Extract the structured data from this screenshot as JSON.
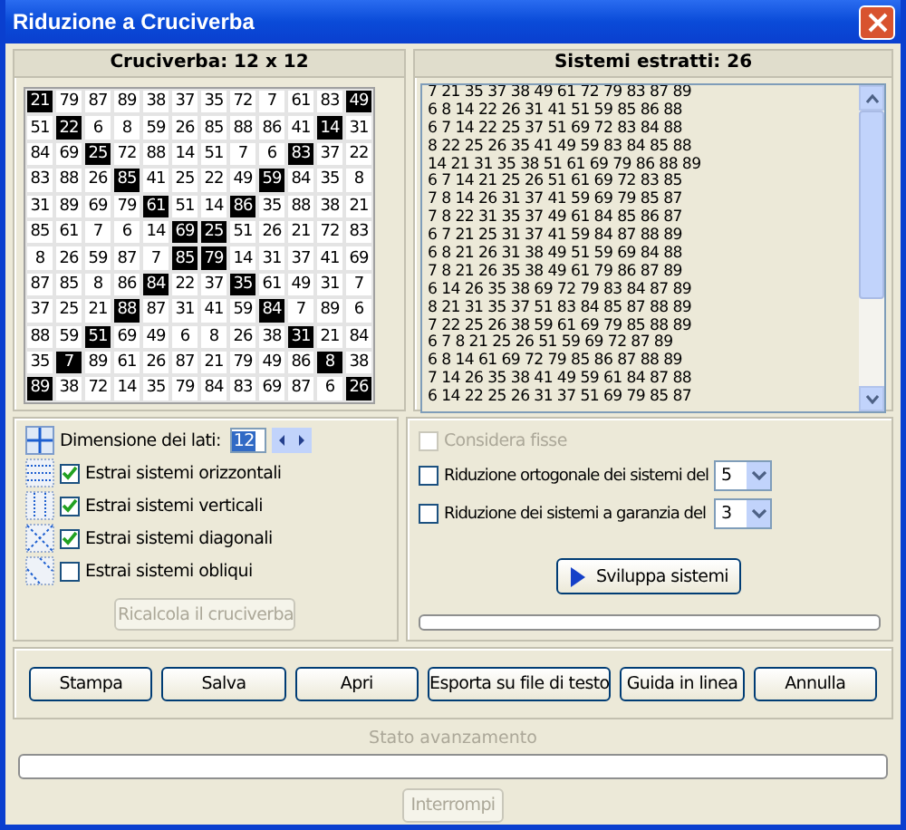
{
  "window": {
    "title": "Riduzione a Cruciverba"
  },
  "grid": {
    "title": "Cruciverba: 12 x 12",
    "rows": [
      [
        {
          "t": "21",
          "marked": true
        },
        {
          "t": "79",
          "marked": false
        },
        {
          "t": "87",
          "marked": false
        },
        {
          "t": "89",
          "marked": false
        },
        {
          "t": "38",
          "marked": false
        },
        {
          "t": "37",
          "marked": false
        },
        {
          "t": "35",
          "marked": false
        },
        {
          "t": "72",
          "marked": false
        },
        {
          "t": "7",
          "marked": false
        },
        {
          "t": "61",
          "marked": false
        },
        {
          "t": "83",
          "marked": false
        },
        {
          "t": "49",
          "marked": true
        }
      ],
      [
        {
          "t": "51",
          "marked": false
        },
        {
          "t": "22",
          "marked": true
        },
        {
          "t": "6",
          "marked": false
        },
        {
          "t": "8",
          "marked": false
        },
        {
          "t": "59",
          "marked": false
        },
        {
          "t": "26",
          "marked": false
        },
        {
          "t": "85",
          "marked": false
        },
        {
          "t": "88",
          "marked": false
        },
        {
          "t": "86",
          "marked": false
        },
        {
          "t": "41",
          "marked": false
        },
        {
          "t": "14",
          "marked": true
        },
        {
          "t": "31",
          "marked": false
        }
      ],
      [
        {
          "t": "84",
          "marked": false
        },
        {
          "t": "69",
          "marked": false
        },
        {
          "t": "25",
          "marked": true
        },
        {
          "t": "72",
          "marked": false
        },
        {
          "t": "88",
          "marked": false
        },
        {
          "t": "14",
          "marked": false
        },
        {
          "t": "51",
          "marked": false
        },
        {
          "t": "7",
          "marked": false
        },
        {
          "t": "6",
          "marked": false
        },
        {
          "t": "83",
          "marked": true
        },
        {
          "t": "37",
          "marked": false
        },
        {
          "t": "22",
          "marked": false
        }
      ],
      [
        {
          "t": "83",
          "marked": false
        },
        {
          "t": "88",
          "marked": false
        },
        {
          "t": "26",
          "marked": false
        },
        {
          "t": "85",
          "marked": true
        },
        {
          "t": "41",
          "marked": false
        },
        {
          "t": "25",
          "marked": false
        },
        {
          "t": "22",
          "marked": false
        },
        {
          "t": "49",
          "marked": false
        },
        {
          "t": "59",
          "marked": true
        },
        {
          "t": "84",
          "marked": false
        },
        {
          "t": "35",
          "marked": false
        },
        {
          "t": "8",
          "marked": false
        }
      ],
      [
        {
          "t": "31",
          "marked": false
        },
        {
          "t": "89",
          "marked": false
        },
        {
          "t": "69",
          "marked": false
        },
        {
          "t": "79",
          "marked": false
        },
        {
          "t": "61",
          "marked": true
        },
        {
          "t": "51",
          "marked": false
        },
        {
          "t": "14",
          "marked": false
        },
        {
          "t": "86",
          "marked": true
        },
        {
          "t": "35",
          "marked": false
        },
        {
          "t": "88",
          "marked": false
        },
        {
          "t": "38",
          "marked": false
        },
        {
          "t": "21",
          "marked": false
        }
      ],
      [
        {
          "t": "85",
          "marked": false
        },
        {
          "t": "61",
          "marked": false
        },
        {
          "t": "7",
          "marked": false
        },
        {
          "t": "6",
          "marked": false
        },
        {
          "t": "14",
          "marked": false
        },
        {
          "t": "69",
          "marked": true
        },
        {
          "t": "25",
          "marked": true
        },
        {
          "t": "51",
          "marked": false
        },
        {
          "t": "26",
          "marked": false
        },
        {
          "t": "21",
          "marked": false
        },
        {
          "t": "72",
          "marked": false
        },
        {
          "t": "83",
          "marked": false
        }
      ],
      [
        {
          "t": "8",
          "marked": false
        },
        {
          "t": "26",
          "marked": false
        },
        {
          "t": "59",
          "marked": false
        },
        {
          "t": "87",
          "marked": false
        },
        {
          "t": "7",
          "marked": false
        },
        {
          "t": "85",
          "marked": true
        },
        {
          "t": "79",
          "marked": true
        },
        {
          "t": "14",
          "marked": false
        },
        {
          "t": "31",
          "marked": false
        },
        {
          "t": "37",
          "marked": false
        },
        {
          "t": "41",
          "marked": false
        },
        {
          "t": "69",
          "marked": false
        }
      ],
      [
        {
          "t": "87",
          "marked": false
        },
        {
          "t": "85",
          "marked": false
        },
        {
          "t": "8",
          "marked": false
        },
        {
          "t": "86",
          "marked": false
        },
        {
          "t": "84",
          "marked": true
        },
        {
          "t": "22",
          "marked": false
        },
        {
          "t": "37",
          "marked": false
        },
        {
          "t": "35",
          "marked": true
        },
        {
          "t": "61",
          "marked": false
        },
        {
          "t": "49",
          "marked": false
        },
        {
          "t": "31",
          "marked": false
        },
        {
          "t": "7",
          "marked": false
        }
      ],
      [
        {
          "t": "37",
          "marked": false
        },
        {
          "t": "25",
          "marked": false
        },
        {
          "t": "21",
          "marked": false
        },
        {
          "t": "88",
          "marked": true
        },
        {
          "t": "87",
          "marked": false
        },
        {
          "t": "31",
          "marked": false
        },
        {
          "t": "41",
          "marked": false
        },
        {
          "t": "59",
          "marked": false
        },
        {
          "t": "84",
          "marked": true
        },
        {
          "t": "7",
          "marked": false
        },
        {
          "t": "89",
          "marked": false
        },
        {
          "t": "6",
          "marked": false
        }
      ],
      [
        {
          "t": "88",
          "marked": false
        },
        {
          "t": "59",
          "marked": false
        },
        {
          "t": "51",
          "marked": true
        },
        {
          "t": "69",
          "marked": false
        },
        {
          "t": "49",
          "marked": false
        },
        {
          "t": "6",
          "marked": false
        },
        {
          "t": "8",
          "marked": false
        },
        {
          "t": "26",
          "marked": false
        },
        {
          "t": "38",
          "marked": false
        },
        {
          "t": "31",
          "marked": true
        },
        {
          "t": "21",
          "marked": false
        },
        {
          "t": "84",
          "marked": false
        }
      ],
      [
        {
          "t": "35",
          "marked": false
        },
        {
          "t": "7",
          "marked": true
        },
        {
          "t": "89",
          "marked": false
        },
        {
          "t": "61",
          "marked": false
        },
        {
          "t": "26",
          "marked": false
        },
        {
          "t": "87",
          "marked": false
        },
        {
          "t": "21",
          "marked": false
        },
        {
          "t": "79",
          "marked": false
        },
        {
          "t": "49",
          "marked": false
        },
        {
          "t": "86",
          "marked": false
        },
        {
          "t": "8",
          "marked": true
        },
        {
          "t": "38",
          "marked": false
        }
      ],
      [
        {
          "t": "89",
          "marked": true
        },
        {
          "t": "38",
          "marked": false
        },
        {
          "t": "72",
          "marked": false
        },
        {
          "t": "14",
          "marked": false
        },
        {
          "t": "35",
          "marked": false
        },
        {
          "t": "79",
          "marked": false
        },
        {
          "t": "84",
          "marked": false
        },
        {
          "t": "83",
          "marked": false
        },
        {
          "t": "69",
          "marked": false
        },
        {
          "t": "87",
          "marked": false
        },
        {
          "t": "6",
          "marked": false
        },
        {
          "t": "26",
          "marked": true
        }
      ]
    ]
  },
  "systems": {
    "title": "Sistemi estratti: 26",
    "lines": [
      "7 21 35 37 38 49 61 72 79 83 87 89",
      "6 8 14 22 26 31 41 51 59 85 86 88",
      "6 7 14 22 25 37 51 69 72 83 84 88",
      "8 22 25 26 35 41 49 59 83 84 85 88",
      "14 21 31 35 38 51 61 69 79 86 88 89",
      "6 7 14 21 25 26 51 61 69 72 83 85",
      "7 8 14 26 31 37 41 59 69 79 85 87",
      "7 8 22 31 35 37 49 61 84 85 86 87",
      "6 7 21 25 31 37 41 59 84 87 88 89",
      "6 8 21 26 31 38 49 51 59 69 84 88",
      "7 8 21 26 35 38 49 61 79 86 87 89",
      "6 14 26 35 38 69 72 79 83 84 87 89",
      "8 21 31 35 37 51 83 84 85 87 88 89",
      "7 22 25 26 38 59 61 69 79 85 88 89",
      "6 7 8 21 25 26 51 59 69 72 87 89",
      "6 8 14 61 69 72 79 85 86 87 88 89",
      "7 14 26 35 38 41 49 59 61 84 87 88",
      "6 14 22 25 26 31 37 51 69 79 85 87"
    ]
  },
  "size_field": {
    "label": "Dimensione dei lati:",
    "value": "12"
  },
  "extract_options": [
    {
      "kind": "horizontal",
      "label": "Estrai sistemi orizzontali",
      "checked": true
    },
    {
      "kind": "vertical",
      "label": "Estrai sistemi verticali",
      "checked": true
    },
    {
      "kind": "diagonal",
      "label": "Estrai sistemi diagonali",
      "checked": true
    },
    {
      "kind": "oblique",
      "label": "Estrai sistemi obliqui",
      "checked": false
    }
  ],
  "recalc_button": {
    "label": "Ricalcola il cruciverba",
    "disabled": true
  },
  "fixed_option": {
    "label": "Considera fisse",
    "checked": false,
    "disabled": true
  },
  "reductions": [
    {
      "label": "Riduzione ortogonale dei sistemi del",
      "checked": false,
      "value": "5"
    },
    {
      "label": "Riduzione dei sistemi a garanzia del",
      "checked": false,
      "value": "3"
    }
  ],
  "develop_button": {
    "label": "Sviluppa sistemi"
  },
  "develop_progress": {
    "level": 0
  },
  "actions": [
    "Stampa",
    "Salva",
    "Apri",
    "Esporta su file di testo",
    "Guida in linea",
    "Annulla"
  ],
  "status": {
    "label": "Stato avanzamento",
    "level": 0
  },
  "stop_button": {
    "label": "Interrompi",
    "disabled": true
  }
}
